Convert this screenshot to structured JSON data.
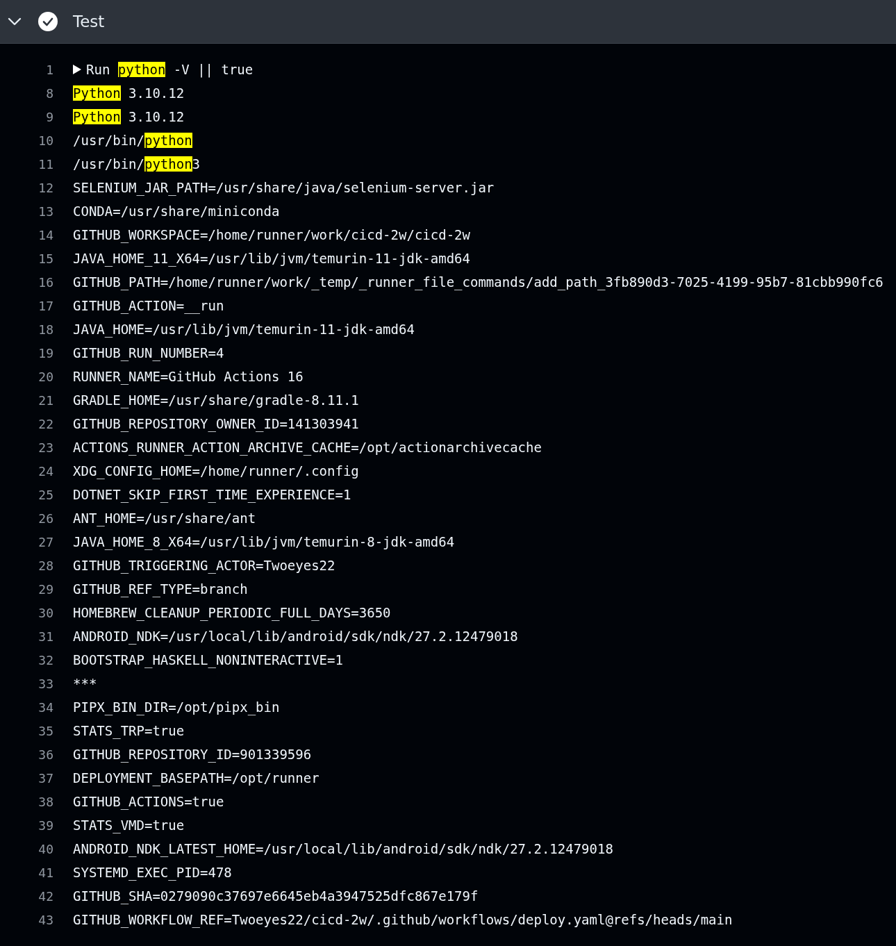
{
  "step": {
    "title": "Test",
    "expanded": true,
    "succeeded": true
  },
  "log": [
    {
      "number": "1",
      "collapsed": true,
      "segments": [
        {
          "text": "Run ",
          "highlighted": false
        },
        {
          "text": "python",
          "highlighted": true
        },
        {
          "text": " -V || true",
          "highlighted": false
        }
      ]
    },
    {
      "number": "8",
      "segments": [
        {
          "text": "Python",
          "highlighted": true
        },
        {
          "text": " 3.10.12",
          "highlighted": false
        }
      ]
    },
    {
      "number": "9",
      "segments": [
        {
          "text": "Python",
          "highlighted": true
        },
        {
          "text": " 3.10.12",
          "highlighted": false
        }
      ]
    },
    {
      "number": "10",
      "segments": [
        {
          "text": "/usr/bin/",
          "highlighted": false
        },
        {
          "text": "python",
          "highlighted": true
        }
      ]
    },
    {
      "number": "11",
      "segments": [
        {
          "text": "/usr/bin/",
          "highlighted": false
        },
        {
          "text": "python",
          "highlighted": true
        },
        {
          "text": "3",
          "highlighted": false
        }
      ]
    },
    {
      "number": "12",
      "segments": [
        {
          "text": "SELENIUM_JAR_PATH=/usr/share/java/selenium-server.jar",
          "highlighted": false
        }
      ]
    },
    {
      "number": "13",
      "segments": [
        {
          "text": "CONDA=/usr/share/miniconda",
          "highlighted": false
        }
      ]
    },
    {
      "number": "14",
      "segments": [
        {
          "text": "GITHUB_WORKSPACE=/home/runner/work/cicd-2w/cicd-2w",
          "highlighted": false
        }
      ]
    },
    {
      "number": "15",
      "segments": [
        {
          "text": "JAVA_HOME_11_X64=/usr/lib/jvm/temurin-11-jdk-amd64",
          "highlighted": false
        }
      ]
    },
    {
      "number": "16",
      "segments": [
        {
          "text": "GITHUB_PATH=/home/runner/work/_temp/_runner_file_commands/add_path_3fb890d3-7025-4199-95b7-81cbb990fc6",
          "highlighted": false
        }
      ]
    },
    {
      "number": "17",
      "segments": [
        {
          "text": "GITHUB_ACTION=__run",
          "highlighted": false
        }
      ]
    },
    {
      "number": "18",
      "segments": [
        {
          "text": "JAVA_HOME=/usr/lib/jvm/temurin-11-jdk-amd64",
          "highlighted": false
        }
      ]
    },
    {
      "number": "19",
      "segments": [
        {
          "text": "GITHUB_RUN_NUMBER=4",
          "highlighted": false
        }
      ]
    },
    {
      "number": "20",
      "segments": [
        {
          "text": "RUNNER_NAME=GitHub Actions 16",
          "highlighted": false
        }
      ]
    },
    {
      "number": "21",
      "segments": [
        {
          "text": "GRADLE_HOME=/usr/share/gradle-8.11.1",
          "highlighted": false
        }
      ]
    },
    {
      "number": "22",
      "segments": [
        {
          "text": "GITHUB_REPOSITORY_OWNER_ID=141303941",
          "highlighted": false
        }
      ]
    },
    {
      "number": "23",
      "segments": [
        {
          "text": "ACTIONS_RUNNER_ACTION_ARCHIVE_CACHE=/opt/actionarchivecache",
          "highlighted": false
        }
      ]
    },
    {
      "number": "24",
      "segments": [
        {
          "text": "XDG_CONFIG_HOME=/home/runner/.config",
          "highlighted": false
        }
      ]
    },
    {
      "number": "25",
      "segments": [
        {
          "text": "DOTNET_SKIP_FIRST_TIME_EXPERIENCE=1",
          "highlighted": false
        }
      ]
    },
    {
      "number": "26",
      "segments": [
        {
          "text": "ANT_HOME=/usr/share/ant",
          "highlighted": false
        }
      ]
    },
    {
      "number": "27",
      "segments": [
        {
          "text": "JAVA_HOME_8_X64=/usr/lib/jvm/temurin-8-jdk-amd64",
          "highlighted": false
        }
      ]
    },
    {
      "number": "28",
      "segments": [
        {
          "text": "GITHUB_TRIGGERING_ACTOR=Twoeyes22",
          "highlighted": false
        }
      ]
    },
    {
      "number": "29",
      "segments": [
        {
          "text": "GITHUB_REF_TYPE=branch",
          "highlighted": false
        }
      ]
    },
    {
      "number": "30",
      "segments": [
        {
          "text": "HOMEBREW_CLEANUP_PERIODIC_FULL_DAYS=3650",
          "highlighted": false
        }
      ]
    },
    {
      "number": "31",
      "segments": [
        {
          "text": "ANDROID_NDK=/usr/local/lib/android/sdk/ndk/27.2.12479018",
          "highlighted": false
        }
      ]
    },
    {
      "number": "32",
      "segments": [
        {
          "text": "BOOTSTRAP_HASKELL_NONINTERACTIVE=1",
          "highlighted": false
        }
      ]
    },
    {
      "number": "33",
      "segments": [
        {
          "text": "***",
          "highlighted": false
        }
      ]
    },
    {
      "number": "34",
      "segments": [
        {
          "text": "PIPX_BIN_DIR=/opt/pipx_bin",
          "highlighted": false
        }
      ]
    },
    {
      "number": "35",
      "segments": [
        {
          "text": "STATS_TRP=true",
          "highlighted": false
        }
      ]
    },
    {
      "number": "36",
      "segments": [
        {
          "text": "GITHUB_REPOSITORY_ID=901339596",
          "highlighted": false
        }
      ]
    },
    {
      "number": "37",
      "segments": [
        {
          "text": "DEPLOYMENT_BASEPATH=/opt/runner",
          "highlighted": false
        }
      ]
    },
    {
      "number": "38",
      "segments": [
        {
          "text": "GITHUB_ACTIONS=true",
          "highlighted": false
        }
      ]
    },
    {
      "number": "39",
      "segments": [
        {
          "text": "STATS_VMD=true",
          "highlighted": false
        }
      ]
    },
    {
      "number": "40",
      "segments": [
        {
          "text": "ANDROID_NDK_LATEST_HOME=/usr/local/lib/android/sdk/ndk/27.2.12479018",
          "highlighted": false
        }
      ]
    },
    {
      "number": "41",
      "segments": [
        {
          "text": "SYSTEMD_EXEC_PID=478",
          "highlighted": false
        }
      ]
    },
    {
      "number": "42",
      "segments": [
        {
          "text": "GITHUB_SHA=0279090c37697e6645eb4a3947525dfc867e179f",
          "highlighted": false
        }
      ]
    },
    {
      "number": "43",
      "segments": [
        {
          "text": "GITHUB_WORKFLOW_REF=Twoeyes22/cicd-2w/.github/workflows/deploy.yaml@refs/heads/main",
          "highlighted": false
        }
      ]
    }
  ]
}
